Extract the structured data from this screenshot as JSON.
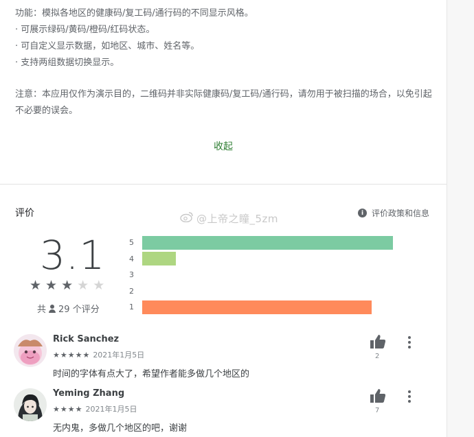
{
  "description": {
    "lines": [
      "功能：模拟各地区的健康码/复工码/通行码的不同显示风格。",
      "· 可展示绿码/黄码/橙码/红码状态。",
      "· 可自定义显示数据，如地区、城市、姓名等。",
      "· 支持两组数据切换显示。"
    ],
    "notice": "注意：本应用仅作为演示目的，二维码并非实际健康码/复工码/通行码，请勿用于被扫描的场合，以免引起不必要的误会。",
    "collapse_label": "收起"
  },
  "ratings": {
    "title": "评价",
    "policy_label": "评价政策和信息",
    "score": "3.1",
    "stars_filled": 3,
    "stars_total": 5,
    "count_prefix": "共",
    "count_text": "29 个评分",
    "bars": [
      {
        "label": "5",
        "fraction": 0.96,
        "color": "#7ccba2"
      },
      {
        "label": "4",
        "fraction": 0.13,
        "color": "#aed681"
      },
      {
        "label": "3",
        "fraction": 0.0,
        "color": "#ffd54f"
      },
      {
        "label": "2",
        "fraction": 0.0,
        "color": "#ffb74d"
      },
      {
        "label": "1",
        "fraction": 0.88,
        "color": "#ff8a5b"
      }
    ]
  },
  "watermark": "@上帝之瞳_5zm",
  "reviews": [
    {
      "name": "Rick Sanchez",
      "stars": "★★★★★",
      "date": "2021年1月5日",
      "text": "时间的字体有点大了，希望作者能多做几个地区的",
      "likes": "2"
    },
    {
      "name": "Yeming Zhang",
      "stars": "★★★★",
      "date": "2021年1月5日",
      "text": "无内鬼，多做几个地区的吧，谢谢",
      "likes": "7"
    }
  ]
}
